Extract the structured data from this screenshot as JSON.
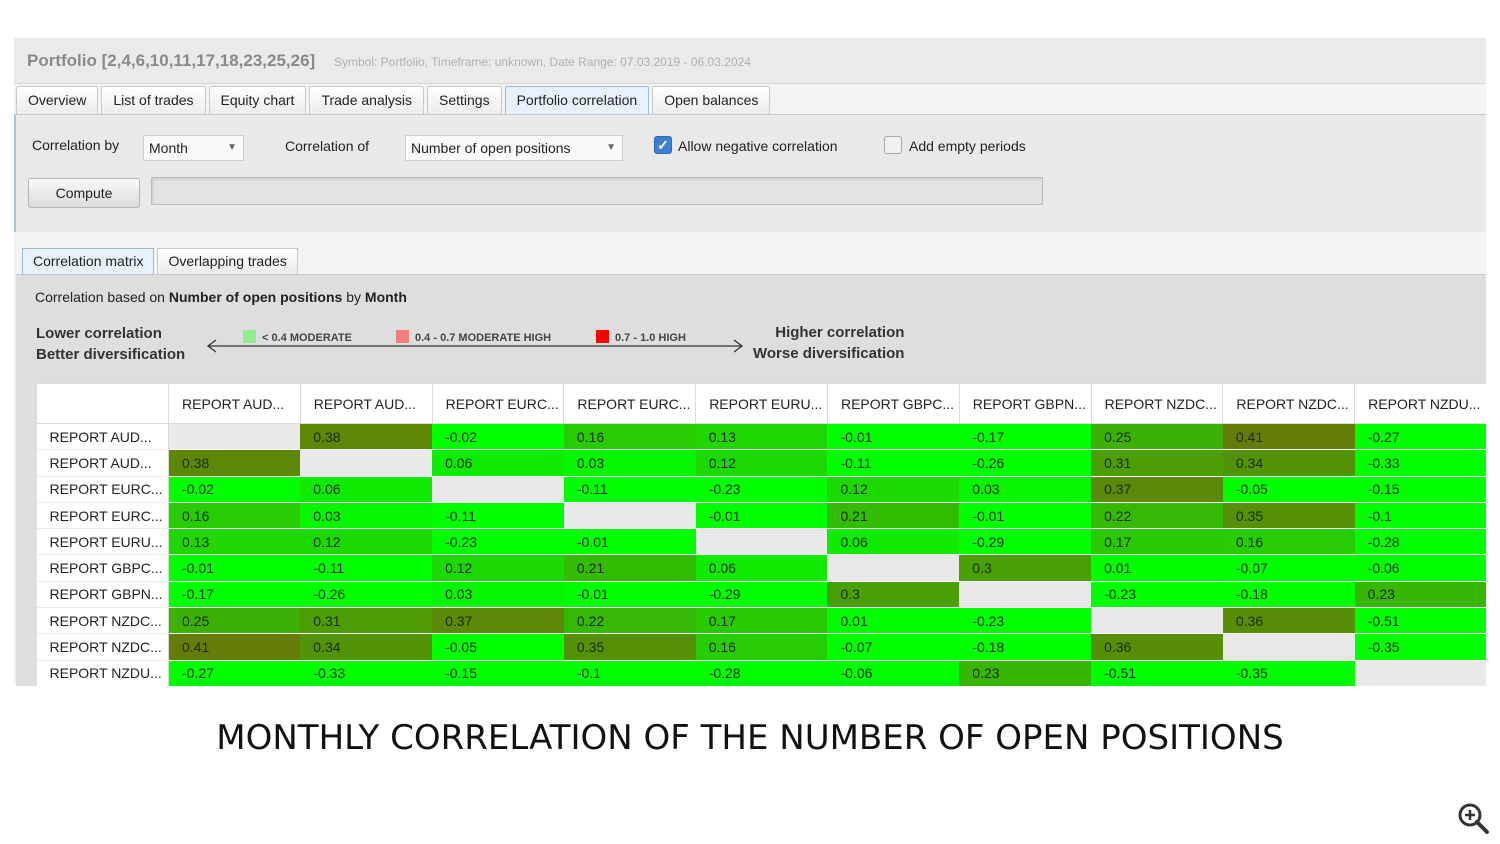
{
  "window": {
    "title": "Portfolio [2,4,6,10,11,17,18,23,25,26]",
    "subtitle": "Symbol: Portfolio, Timeframe: unknown, Date Range: 07.03.2019 - 06.03.2024"
  },
  "tabs": [
    {
      "label": "Overview",
      "active": false
    },
    {
      "label": "List of trades",
      "active": false
    },
    {
      "label": "Equity chart",
      "active": false
    },
    {
      "label": "Trade analysis",
      "active": false
    },
    {
      "label": "Settings",
      "active": false
    },
    {
      "label": "Portfolio correlation",
      "active": true
    },
    {
      "label": "Open balances",
      "active": false
    }
  ],
  "controls": {
    "correlation_by_label": "Correlation by",
    "correlation_by_value": "Month",
    "correlation_of_label": "Correlation of",
    "correlation_of_value": "Number of open positions",
    "allow_negative_label": "Allow negative correlation",
    "allow_negative_checked": true,
    "add_empty_label": "Add empty periods",
    "add_empty_checked": false,
    "compute_label": "Compute",
    "progress": 0
  },
  "subtabs": [
    {
      "label": "Correlation matrix",
      "active": true
    },
    {
      "label": "Overlapping trades",
      "active": false
    }
  ],
  "caption": {
    "prefix": "Correlation based on ",
    "metric": "Number of open positions",
    "middle": " by ",
    "period": "Month"
  },
  "legend": {
    "lower_line1": "Lower correlation",
    "lower_line2": "Better diversification",
    "higher_line1": "Higher correlation",
    "higher_line2": "Worse diversification",
    "items": [
      {
        "label": "< 0.4 MODERATE",
        "color": "#90ee90"
      },
      {
        "label": "0.4 - 0.7 MODERATE HIGH",
        "color": "#f08080"
      },
      {
        "label": "0.7 - 1.0 HIGH",
        "color": "#ff0000"
      }
    ]
  },
  "matrix": {
    "columns": [
      "REPORT AUD...",
      "REPORT AUD...",
      "REPORT EURC...",
      "REPORT EURC...",
      "REPORT EURU...",
      "REPORT GBPC...",
      "REPORT GBPN...",
      "REPORT NZDC...",
      "REPORT NZDC...",
      "REPORT NZDU..."
    ],
    "rows": [
      {
        "label": "REPORT AUD...",
        "values": [
          "",
          "0.38",
          "-0.02",
          "0.16",
          "0.13",
          "-0.01",
          "-0.17",
          "0.25",
          "0.41",
          "-0.27"
        ]
      },
      {
        "label": "REPORT AUD...",
        "values": [
          "0.38",
          "",
          "0.06",
          "0.03",
          "0.12",
          "-0.11",
          "-0.26",
          "0.31",
          "0.34",
          "-0.33"
        ]
      },
      {
        "label": "REPORT EURC...",
        "values": [
          "-0.02",
          "0.06",
          "",
          "-0.11",
          "-0.23",
          "0.12",
          "0.03",
          "0.37",
          "-0.05",
          "-0.15"
        ]
      },
      {
        "label": "REPORT EURC...",
        "values": [
          "0.16",
          "0.03",
          "-0.11",
          "",
          "-0.01",
          "0.21",
          "-0.01",
          "0.22",
          "0.35",
          "-0.1"
        ]
      },
      {
        "label": "REPORT EURU...",
        "values": [
          "0.13",
          "0.12",
          "-0.23",
          "-0.01",
          "",
          "0.06",
          "-0.29",
          "0.17",
          "0.16",
          "-0.28"
        ]
      },
      {
        "label": "REPORT GBPC...",
        "values": [
          "-0.01",
          "-0.11",
          "0.12",
          "0.21",
          "0.06",
          "",
          "0.3",
          "0.01",
          "-0.07",
          "-0.06"
        ]
      },
      {
        "label": "REPORT GBPN...",
        "values": [
          "-0.17",
          "-0.26",
          "0.03",
          "-0.01",
          "-0.29",
          "0.3",
          "",
          "-0.23",
          "-0.18",
          "0.23"
        ]
      },
      {
        "label": "REPORT NZDC...",
        "values": [
          "0.25",
          "0.31",
          "0.37",
          "0.22",
          "0.17",
          "0.01",
          "-0.23",
          "",
          "0.36",
          "-0.51"
        ]
      },
      {
        "label": "REPORT NZDC...",
        "values": [
          "0.41",
          "0.34",
          "-0.05",
          "0.35",
          "0.16",
          "-0.07",
          "-0.18",
          "0.36",
          "",
          "-0.35"
        ]
      },
      {
        "label": "REPORT NZDU...",
        "values": [
          "-0.27",
          "-0.33",
          "-0.15",
          "-0.1",
          "-0.28",
          "-0.06",
          "0.23",
          "-0.51",
          "-0.35",
          ""
        ]
      }
    ]
  },
  "footer": {
    "heading": "MONTHLY CORRELATION OF THE NUMBER OF OPEN POSITIONS"
  },
  "icons": {
    "zoom": "zoom-in-icon"
  }
}
